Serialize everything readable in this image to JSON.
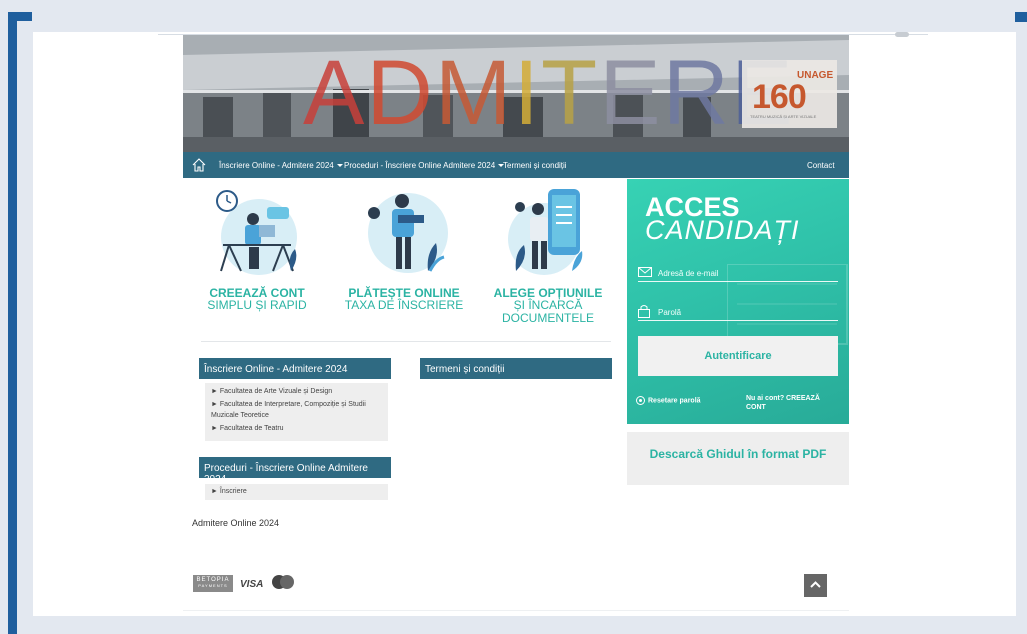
{
  "header": {
    "title_letters": [
      "A",
      "D",
      "M",
      "I",
      "T",
      "E",
      "R",
      "E"
    ],
    "title_colors": [
      "#c8403a",
      "#d14a31",
      "#c65a35",
      "#d4ad38",
      "#b8a246",
      "#8d8fa1",
      "#6f79a1",
      "#4d5f99"
    ],
    "logo_number": "160",
    "logo_brand": "UNAGE",
    "logo_subtitle": "TEATRU MUZICĂ ȘI ARTE VIZUALE"
  },
  "nav": {
    "home_icon": "home-icon",
    "items": [
      {
        "label": "Înscriere Online - Admitere 2024",
        "dropdown": true
      },
      {
        "label": "Proceduri - Înscriere Online Admitere 2024",
        "dropdown": true
      },
      {
        "label": "Termeni și condiții",
        "dropdown": false
      }
    ],
    "contact": "Contact"
  },
  "features": [
    {
      "title": "CREEAZĂ CONT",
      "subtitle": "SIMPLU ȘI RAPID"
    },
    {
      "title": "PLĂTEȘTE ONLINE",
      "subtitle": "TAXA DE ÎNSCRIERE"
    },
    {
      "title": "ALEGE OPȚIUNILE",
      "subtitle": "ȘI ÎNCARCĂ DOCUMENTELE"
    }
  ],
  "panels": {
    "inscriere": {
      "title": "Înscriere Online - Admitere 2024",
      "items": [
        "► Facultatea de Arte Vizuale și Design",
        "► Facultatea de Interpretare, Compoziție și Studii Muzicale Teoretice",
        "► Facultatea de Teatru"
      ]
    },
    "proceduri": {
      "title": "Proceduri - Înscriere Online Admitere 2024",
      "items": [
        "► Înscriere"
      ]
    },
    "termeni": {
      "title": "Termeni și condiții"
    }
  },
  "admitere_online": "Admitere Online 2024",
  "login": {
    "title_line1": "ACCES",
    "title_line2": "CANDIDAȚI",
    "email_placeholder": "Adresă de e-mail",
    "password_placeholder": "Parolă",
    "submit_label": "Autentificare",
    "reset_label": "Resetare parolă",
    "signup_label": "Nu ai cont? CREEAZĂ CONT"
  },
  "guide_label": "Descarcă Ghidul în format PDF",
  "footer": {
    "betopia_line1": "BETOPIA",
    "betopia_line2": "PAYMENTS",
    "visa": "VISA",
    "mastercard_label": "mastercard"
  },
  "colors": {
    "nav": "#2f6a82",
    "accent": "#2bb3a3",
    "login_bg": "#2fc1a9"
  }
}
